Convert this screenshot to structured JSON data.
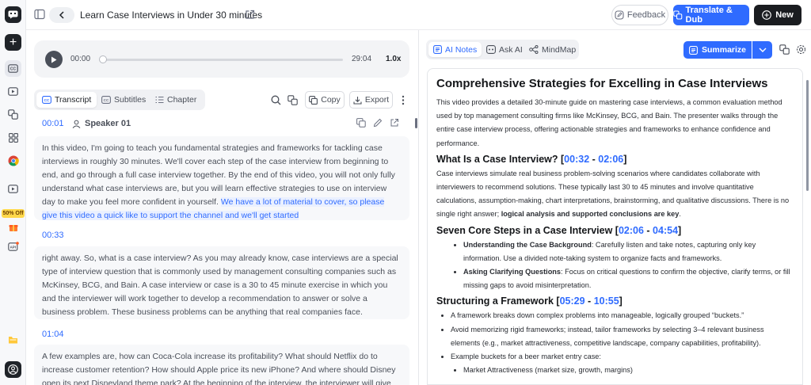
{
  "header": {
    "title": "Learn Case Interviews in Under 30 minutes",
    "feedback": "Feedback",
    "translate": "Translate & Dub",
    "new": "New"
  },
  "rail": {
    "promo": "50% Off"
  },
  "player": {
    "current": "00:00",
    "duration": "29:04",
    "speed": "1.0x",
    "progress": 0
  },
  "left_tabs": [
    "Transcript",
    "Subtitles",
    "Chapter"
  ],
  "left_tools": {
    "copy": "Copy",
    "export": "Export"
  },
  "segments": [
    {
      "time": "00:01",
      "speaker": "Speaker 01",
      "text": "In this video, I'm going to teach you fundamental strategies and frameworks for tackling case interviews in roughly 30 minutes. We'll cover each step of the case interview from beginning to end, and go through a full case interview together. By the end of this video, you will not only fully understand what case interviews are, but you will learn effective strategies to use on interview day to make you feel more confident in yourself. ",
      "highlight": "We have a lot of material to cover, so please give this video a quick like to support the channel and we'll get started"
    },
    {
      "time": "00:33",
      "text": "right away. So, what is a case interview? As you may already know, case interviews are a special type of interview question that is commonly used by management consulting companies such as McKinsey, BCG, and Bain. A case interview or case is a 30 to 45 minute exercise in which you and the interviewer will work together to develop a recommendation to answer or solve a business problem. These business problems can be anything that real companies face."
    },
    {
      "time": "01:04",
      "text": "A few examples are, how can Coca-Cola increase its profitability? What should Netflix do to increase customer retention? How should Apple price its new iPhone? And where should Disney open its next Disneyland theme park? At the beginning of the interview, the interviewer will give"
    }
  ],
  "right_tabs": [
    "AI Notes",
    "Ask AI",
    "MindMap"
  ],
  "summarize": "Summarize",
  "notes": {
    "title": "Comprehensive Strategies for Excelling in Case Interviews",
    "intro": "This video provides a detailed 30-minute guide on mastering case interviews, a common evaluation method used by top management consulting firms like McKinsey, BCG, and Bain. The presenter walks through the entire case interview process, offering actionable strategies and frameworks to enhance confidence and performance.",
    "s1": {
      "heading": "What Is a Case Interview? [",
      "t1": "00:32",
      "sep": " - ",
      "t2": "02:06",
      "close": "]",
      "body": "Case interviews simulate real business problem-solving scenarios where candidates collaborate with interviewers to recommend solutions. These typically last 30 to 45 minutes and involve quantitative calculations, assumption-making, chart interpretations, brainstorming, and qualitative discussions. There is no single right answer; ",
      "bold": "logical analysis and supported conclusions are key",
      "end": "."
    },
    "s2": {
      "heading": "Seven Core Steps in a Case Interview [",
      "t1": "02:06",
      "sep": " - ",
      "t2": "04:54",
      "close": "]",
      "items": [
        {
          "b": "Understanding the Case Background",
          "t": ": Carefully listen and take notes, capturing only key information. Use a divided note-taking system to organize facts and frameworks."
        },
        {
          "b": "Asking Clarifying Questions",
          "t": ": Focus on critical questions to confirm the objective, clarify terms, or fill missing gaps to avoid misinterpretation."
        }
      ]
    },
    "s3": {
      "heading": "Structuring a Framework [",
      "t1": "05:29",
      "sep": " - ",
      "t2": "10:55",
      "close": "]",
      "items": [
        "A framework breaks down complex problems into manageable, logically grouped “buckets.”",
        "Avoid memorizing rigid frameworks; instead, tailor frameworks by selecting 3–4 relevant business elements (e.g., market attractiveness, competitive landscape, company capabilities, profitability).",
        "Example buckets for a beer market entry case:"
      ],
      "sub": [
        "Market Attractiveness (market size, growth, margins)"
      ]
    }
  },
  "colors": {
    "accent": "#2f6bff",
    "dark": "#1a1c20"
  }
}
